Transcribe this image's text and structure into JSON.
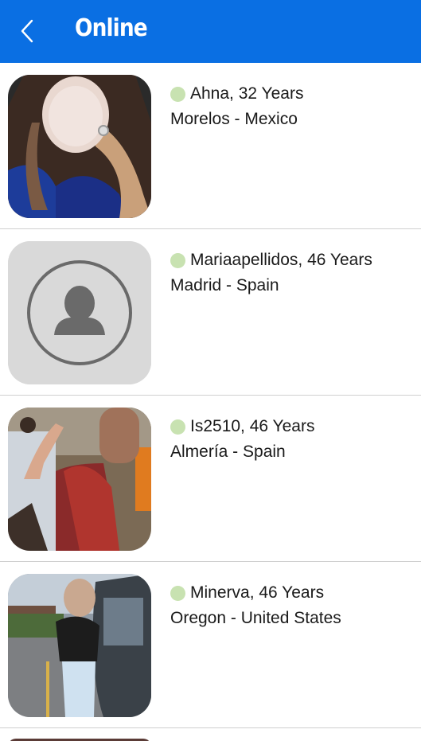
{
  "header": {
    "title": "Online",
    "back_icon": "chevron-left-icon",
    "background": "#0a6fe3"
  },
  "status_color": "#c8e2b1",
  "users": [
    {
      "name_age": "Ahna, 32 Years",
      "location": "Morelos - Mexico",
      "photo": "user-photo"
    },
    {
      "name_age": "Mariaapellidos, 46 Years",
      "location": "Madrid - Spain",
      "photo": "default-avatar-icon"
    },
    {
      "name_age": "Is2510, 46 Years",
      "location": "Almería - Spain",
      "photo": "user-photo"
    },
    {
      "name_age": "Minerva, 46 Years",
      "location": "Oregon - United States",
      "photo": "user-photo"
    }
  ]
}
